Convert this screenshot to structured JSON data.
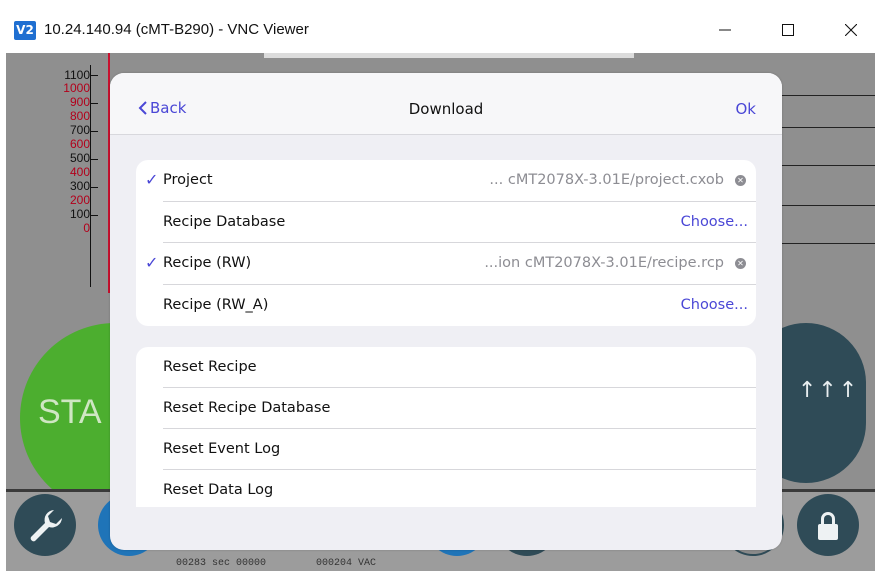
{
  "window": {
    "app_icon_text": "V2",
    "title": "10.24.140.94 (cMT-B290) - VNC Viewer",
    "controls": [
      "minimize",
      "maximize",
      "close"
    ]
  },
  "hmi_background": {
    "scale_ticks": [
      "1100",
      "1000",
      "900",
      "800",
      "700",
      "600",
      "500",
      "400",
      "300",
      "200",
      "100",
      "0"
    ],
    "start_button_text": "STA",
    "status_left": "00283 sec 00000",
    "status_right": "000204 VAC"
  },
  "dialog": {
    "back_label": "Back",
    "title": "Download",
    "ok_label": "Ok",
    "file_rows": [
      {
        "label": "Project",
        "checked": true,
        "value": "... cMT2078X-3.01E/project.cxob",
        "action": "clear"
      },
      {
        "label": "Recipe Database",
        "checked": false,
        "value": "",
        "action": "Choose..."
      },
      {
        "label": "Recipe (RW)",
        "checked": true,
        "value": "...ion cMT2078X-3.01E/recipe.rcp",
        "action": "clear"
      },
      {
        "label": "Recipe (RW_A)",
        "checked": false,
        "value": "",
        "action": "Choose..."
      }
    ],
    "reset_rows": [
      {
        "label": "Reset Recipe"
      },
      {
        "label": "Reset Recipe Database"
      },
      {
        "label": "Reset Event Log"
      },
      {
        "label": "Reset Data Log"
      }
    ]
  },
  "colors": {
    "accent": "#4a47d6",
    "dialog_bg": "#efeff4",
    "hmi_bg": "#8f8f8f",
    "start_green": "#4cae2f",
    "dark_button": "#2f4b57"
  }
}
